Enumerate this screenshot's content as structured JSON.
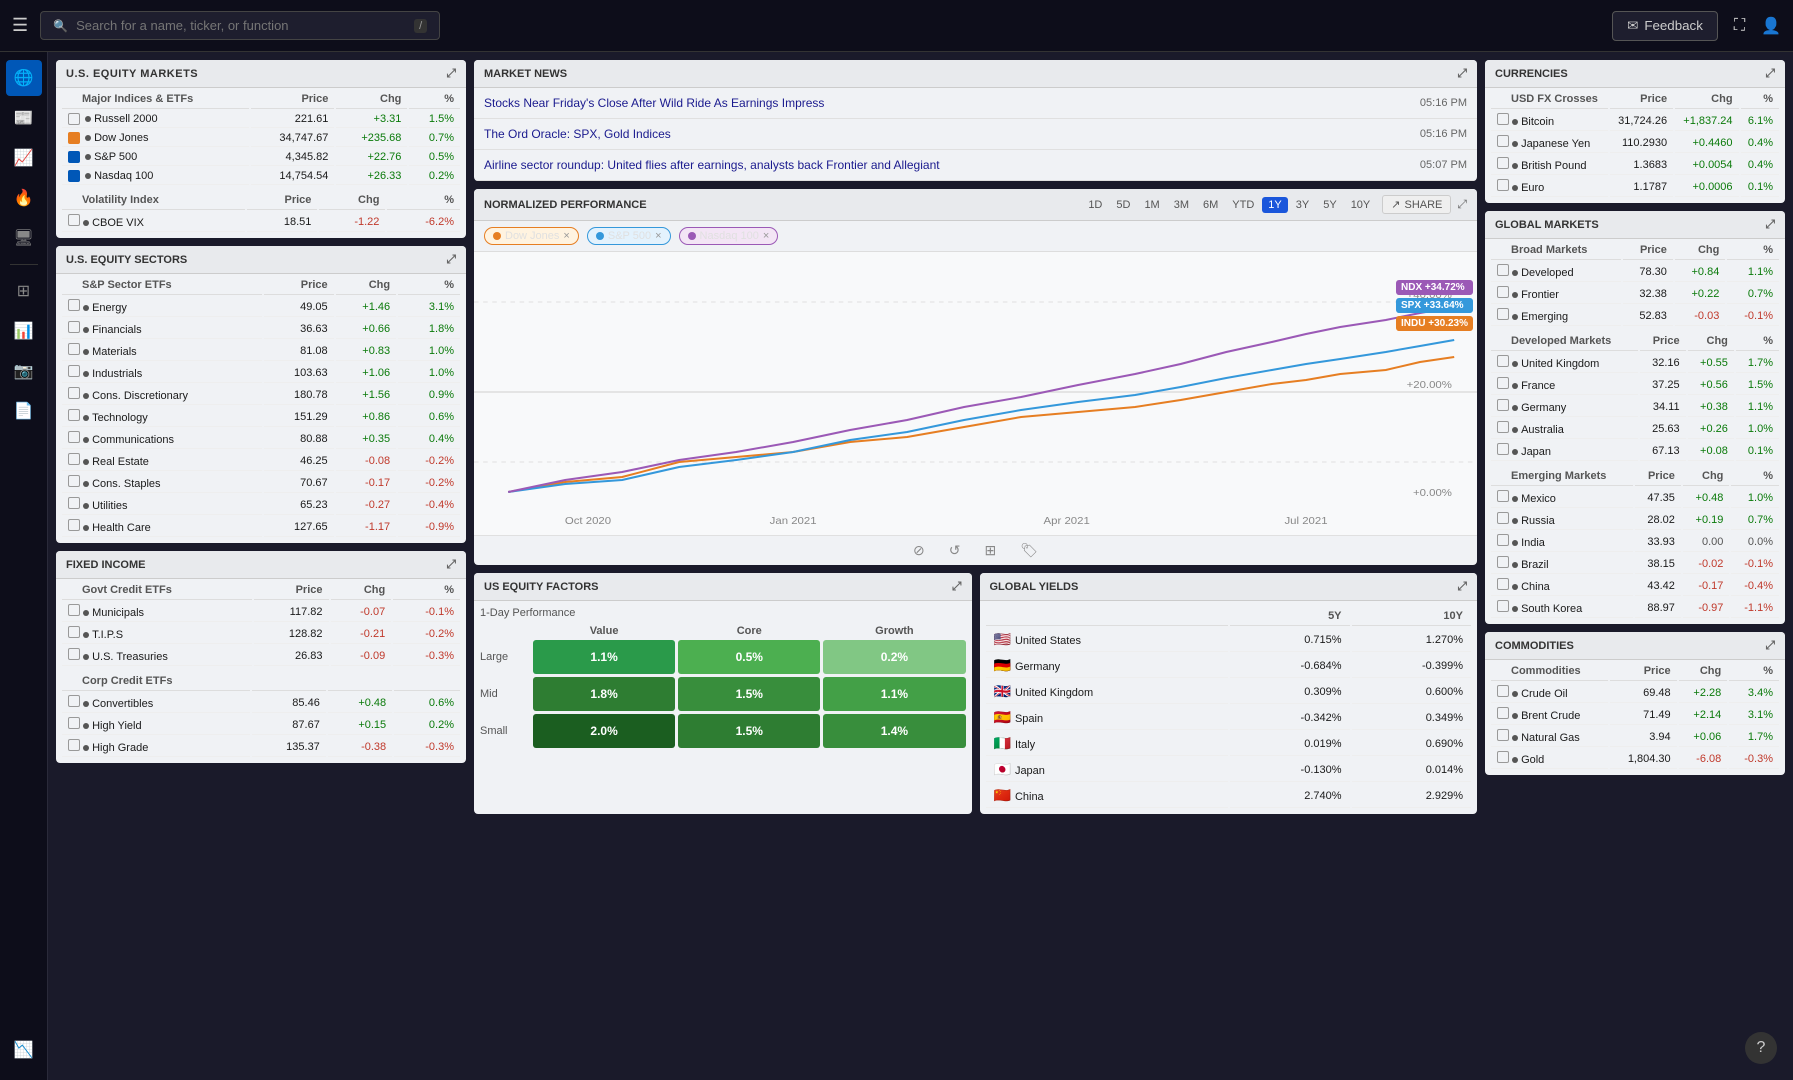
{
  "topbar": {
    "search_placeholder": "Search for a name, ticker, or function",
    "search_shortcut": "/",
    "feedback_label": "Feedback",
    "feedback_icon": "✉"
  },
  "nav": {
    "items": [
      {
        "id": "globe",
        "icon": "🌐",
        "active": true
      },
      {
        "id": "chart",
        "icon": "📈",
        "active": false
      },
      {
        "id": "flame",
        "icon": "🔥",
        "active": false
      },
      {
        "id": "monitor",
        "icon": "🖥",
        "active": false
      },
      {
        "id": "grid",
        "icon": "⊞",
        "active": false
      },
      {
        "id": "bar-chart",
        "icon": "📊",
        "active": false
      },
      {
        "id": "camera",
        "icon": "📷",
        "active": false
      },
      {
        "id": "file",
        "icon": "📄",
        "active": false
      },
      {
        "id": "terminal",
        "icon": "⌨",
        "active": false
      },
      {
        "id": "trend",
        "icon": "📉",
        "active": false
      }
    ]
  },
  "us_equity_markets": {
    "title": "U.S. EQUITY MARKETS",
    "section1_label": "Major Indices & ETFs",
    "col_price": "Price",
    "col_chg": "Chg",
    "col_pct": "%",
    "rows": [
      {
        "name": "Russell 2000",
        "price": "221.61",
        "chg": "+3.31",
        "pct": "1.5%",
        "chg_class": "positive",
        "checked": false,
        "orange": false
      },
      {
        "name": "Dow Jones",
        "price": "34,747.67",
        "chg": "+235.68",
        "pct": "0.7%",
        "chg_class": "positive",
        "checked": false,
        "orange": true
      },
      {
        "name": "S&P 500",
        "price": "4,345.82",
        "chg": "+22.76",
        "pct": "0.5%",
        "chg_class": "positive",
        "checked": true,
        "orange": false
      },
      {
        "name": "Nasdaq 100",
        "price": "14,754.54",
        "chg": "+26.33",
        "pct": "0.2%",
        "chg_class": "positive",
        "checked": true,
        "orange": false
      }
    ],
    "section2_label": "Volatility Index",
    "vol_col_price": "Price",
    "vol_col_chg": "Chg",
    "vol_col_pct": "%",
    "vol_rows": [
      {
        "name": "CBOE VIX",
        "price": "18.51",
        "chg": "-1.22",
        "pct": "-6.2%",
        "chg_class": "negative",
        "checked": false
      }
    ]
  },
  "us_equity_sectors": {
    "title": "U.S. EQUITY SECTORS",
    "section_label": "S&P Sector ETFs",
    "col_price": "Price",
    "col_chg": "Chg",
    "col_pct": "%",
    "rows": [
      {
        "name": "Energy",
        "price": "49.05",
        "chg": "+1.46",
        "pct": "3.1%",
        "chg_class": "positive"
      },
      {
        "name": "Financials",
        "price": "36.63",
        "chg": "+0.66",
        "pct": "1.8%",
        "chg_class": "positive"
      },
      {
        "name": "Materials",
        "price": "81.08",
        "chg": "+0.83",
        "pct": "1.0%",
        "chg_class": "positive"
      },
      {
        "name": "Industrials",
        "price": "103.63",
        "chg": "+1.06",
        "pct": "1.0%",
        "chg_class": "positive"
      },
      {
        "name": "Cons. Discretionary",
        "price": "180.78",
        "chg": "+1.56",
        "pct": "0.9%",
        "chg_class": "positive"
      },
      {
        "name": "Technology",
        "price": "151.29",
        "chg": "+0.86",
        "pct": "0.6%",
        "chg_class": "positive"
      },
      {
        "name": "Communications",
        "price": "80.88",
        "chg": "+0.35",
        "pct": "0.4%",
        "chg_class": "positive"
      },
      {
        "name": "Real Estate",
        "price": "46.25",
        "chg": "-0.08",
        "pct": "-0.2%",
        "chg_class": "negative"
      },
      {
        "name": "Cons. Staples",
        "price": "70.67",
        "chg": "-0.17",
        "pct": "-0.2%",
        "chg_class": "negative"
      },
      {
        "name": "Utilities",
        "price": "65.23",
        "chg": "-0.27",
        "pct": "-0.4%",
        "chg_class": "negative"
      },
      {
        "name": "Health Care",
        "price": "127.65",
        "chg": "-1.17",
        "pct": "-0.9%",
        "chg_class": "negative"
      }
    ]
  },
  "fixed_income": {
    "title": "FIXED INCOME",
    "section1_label": "Govt Credit ETFs",
    "col_price": "Price",
    "col_chg": "Chg",
    "col_pct": "%",
    "rows1": [
      {
        "name": "Municipals",
        "price": "117.82",
        "chg": "-0.07",
        "pct": "-0.1%",
        "chg_class": "negative"
      },
      {
        "name": "T.I.P.S",
        "price": "128.82",
        "chg": "-0.21",
        "pct": "-0.2%",
        "chg_class": "negative"
      },
      {
        "name": "U.S. Treasuries",
        "price": "26.83",
        "chg": "-0.09",
        "pct": "-0.3%",
        "chg_class": "negative"
      }
    ],
    "section2_label": "Corp Credit ETFs",
    "rows2": [
      {
        "name": "Convertibles",
        "price": "85.46",
        "chg": "+0.48",
        "pct": "0.6%",
        "chg_class": "positive"
      },
      {
        "name": "High Yield",
        "price": "87.67",
        "chg": "+0.15",
        "pct": "0.2%",
        "chg_class": "positive"
      },
      {
        "name": "High Grade",
        "price": "135.37",
        "chg": "-0.38",
        "pct": "-0.3%",
        "chg_class": "negative"
      }
    ]
  },
  "market_news": {
    "title": "MARKET NEWS",
    "items": [
      {
        "title": "Stocks Near Friday's Close After Wild Ride As Earnings Impress",
        "time": "05:16 PM"
      },
      {
        "title": "The Ord Oracle: SPX, Gold Indices",
        "time": "05:16 PM"
      },
      {
        "title": "Airline sector roundup: United flies after earnings, analysts back Frontier and Allegiant",
        "time": "05:07 PM"
      }
    ]
  },
  "normalized_performance": {
    "title": "NORMALIZED PERFORMANCE",
    "share_label": "SHARE",
    "time_buttons": [
      "1D",
      "5D",
      "1M",
      "3M",
      "6M",
      "YTD",
      "1Y",
      "3Y",
      "5Y",
      "10Y"
    ],
    "active_time": "1Y",
    "legend": [
      {
        "label": "Dow Jones",
        "color": "#e67e22"
      },
      {
        "label": "S&P 500",
        "color": "#3498db"
      },
      {
        "label": "Nasdaq 100",
        "color": "#9b59b6"
      }
    ],
    "chart_labels": [
      {
        "label": "NDX +34.72%",
        "color": "#9b59b6"
      },
      {
        "label": "SPX +33.64%",
        "color": "#3498db"
      },
      {
        "label": "INDU +30.23%",
        "color": "#e67e22"
      }
    ],
    "x_labels": [
      "Oct 2020",
      "Jan 2021",
      "Apr 2021",
      "Jul 2021"
    ],
    "y_labels": [
      "+40.00%",
      "+20.00%",
      "+0.00%"
    ],
    "footer_icons": [
      "🚫",
      "🔄",
      "⊞",
      "🏷"
    ]
  },
  "us_equity_factors": {
    "title": "US EQUITY FACTORS",
    "subtitle": "1-Day Performance",
    "col_headers": [
      "Value",
      "Core",
      "Growth"
    ],
    "row_headers": [
      "Large",
      "Mid",
      "Small"
    ],
    "cells": [
      [
        "1.1%",
        "0.5%",
        "0.2%"
      ],
      [
        "1.8%",
        "1.5%",
        "1.1%"
      ],
      [
        "2.0%",
        "1.5%",
        "1.4%"
      ]
    ]
  },
  "global_yields": {
    "title": "GLOBAL YIELDS",
    "col_5y": "5Y",
    "col_10y": "10Y",
    "rows": [
      {
        "flag": "🇺🇸",
        "country": "United States",
        "y5": "0.715%",
        "y10": "1.270%"
      },
      {
        "flag": "🇩🇪",
        "country": "Germany",
        "y5": "-0.684%",
        "y10": "-0.399%"
      },
      {
        "flag": "🇬🇧",
        "country": "United Kingdom",
        "y5": "0.309%",
        "y10": "0.600%"
      },
      {
        "flag": "🇪🇸",
        "country": "Spain",
        "y5": "-0.342%",
        "y10": "0.349%"
      },
      {
        "flag": "🇮🇹",
        "country": "Italy",
        "y5": "0.019%",
        "y10": "0.690%"
      },
      {
        "flag": "🇯🇵",
        "country": "Japan",
        "y5": "-0.130%",
        "y10": "0.014%"
      },
      {
        "flag": "🇨🇳",
        "country": "China",
        "y5": "2.740%",
        "y10": "2.929%"
      }
    ]
  },
  "currencies": {
    "title": "CURRENCIES",
    "section_label": "USD FX Crosses",
    "col_price": "Price",
    "col_chg": "Chg",
    "col_pct": "%",
    "rows": [
      {
        "name": "Bitcoin",
        "price": "31,724.26",
        "chg": "+1,837.24",
        "pct": "6.1%",
        "chg_class": "positive"
      },
      {
        "name": "Japanese Yen",
        "price": "110.2930",
        "chg": "+0.4460",
        "pct": "0.4%",
        "chg_class": "positive"
      },
      {
        "name": "British Pound",
        "price": "1.3683",
        "chg": "+0.0054",
        "pct": "0.4%",
        "chg_class": "positive"
      },
      {
        "name": "Euro",
        "price": "1.1787",
        "chg": "+0.0006",
        "pct": "0.1%",
        "chg_class": "positive"
      }
    ]
  },
  "global_markets": {
    "title": "GLOBAL MARKETS",
    "section1_label": "Broad Markets",
    "col_price": "Price",
    "col_chg": "Chg",
    "col_pct": "%",
    "broad_rows": [
      {
        "name": "Developed",
        "price": "78.30",
        "chg": "+0.84",
        "pct": "1.1%",
        "chg_class": "positive"
      },
      {
        "name": "Frontier",
        "price": "32.38",
        "chg": "+0.22",
        "pct": "0.7%",
        "chg_class": "positive"
      },
      {
        "name": "Emerging",
        "price": "52.83",
        "chg": "-0.03",
        "pct": "-0.1%",
        "chg_class": "negative"
      }
    ],
    "section2_label": "Developed Markets",
    "developed_rows": [
      {
        "name": "United Kingdom",
        "price": "32.16",
        "chg": "+0.55",
        "pct": "1.7%",
        "chg_class": "positive"
      },
      {
        "name": "France",
        "price": "37.25",
        "chg": "+0.56",
        "pct": "1.5%",
        "chg_class": "positive"
      },
      {
        "name": "Germany",
        "price": "34.11",
        "chg": "+0.38",
        "pct": "1.1%",
        "chg_class": "positive"
      },
      {
        "name": "Australia",
        "price": "25.63",
        "chg": "+0.26",
        "pct": "1.0%",
        "chg_class": "positive"
      },
      {
        "name": "Japan",
        "price": "67.13",
        "chg": "+0.08",
        "pct": "0.1%",
        "chg_class": "positive"
      }
    ],
    "section3_label": "Emerging Markets",
    "emerging_rows": [
      {
        "name": "Mexico",
        "price": "47.35",
        "chg": "+0.48",
        "pct": "1.0%",
        "chg_class": "positive"
      },
      {
        "name": "Russia",
        "price": "28.02",
        "chg": "+0.19",
        "pct": "0.7%",
        "chg_class": "positive"
      },
      {
        "name": "India",
        "price": "33.93",
        "chg": "0.00",
        "pct": "0.0%",
        "chg_class": "neutral"
      },
      {
        "name": "Brazil",
        "price": "38.15",
        "chg": "-0.02",
        "pct": "-0.1%",
        "chg_class": "negative"
      },
      {
        "name": "China",
        "price": "43.42",
        "chg": "-0.17",
        "pct": "-0.4%",
        "chg_class": "negative"
      },
      {
        "name": "South Korea",
        "price": "88.97",
        "chg": "-0.97",
        "pct": "-1.1%",
        "chg_class": "negative"
      }
    ]
  },
  "commodities": {
    "title": "COMMODITIES",
    "section_label": "Commodities",
    "col_price": "Price",
    "col_chg": "Chg",
    "col_pct": "%",
    "rows": [
      {
        "name": "Crude Oil",
        "price": "69.48",
        "chg": "+2.28",
        "pct": "3.4%",
        "chg_class": "positive"
      },
      {
        "name": "Brent Crude",
        "price": "71.49",
        "chg": "+2.14",
        "pct": "3.1%",
        "chg_class": "positive"
      },
      {
        "name": "Natural Gas",
        "price": "3.94",
        "chg": "+0.06",
        "pct": "1.7%",
        "chg_class": "positive"
      },
      {
        "name": "Gold",
        "price": "1,804.30",
        "chg": "-6.08",
        "pct": "-0.3%",
        "chg_class": "negative"
      }
    ]
  }
}
